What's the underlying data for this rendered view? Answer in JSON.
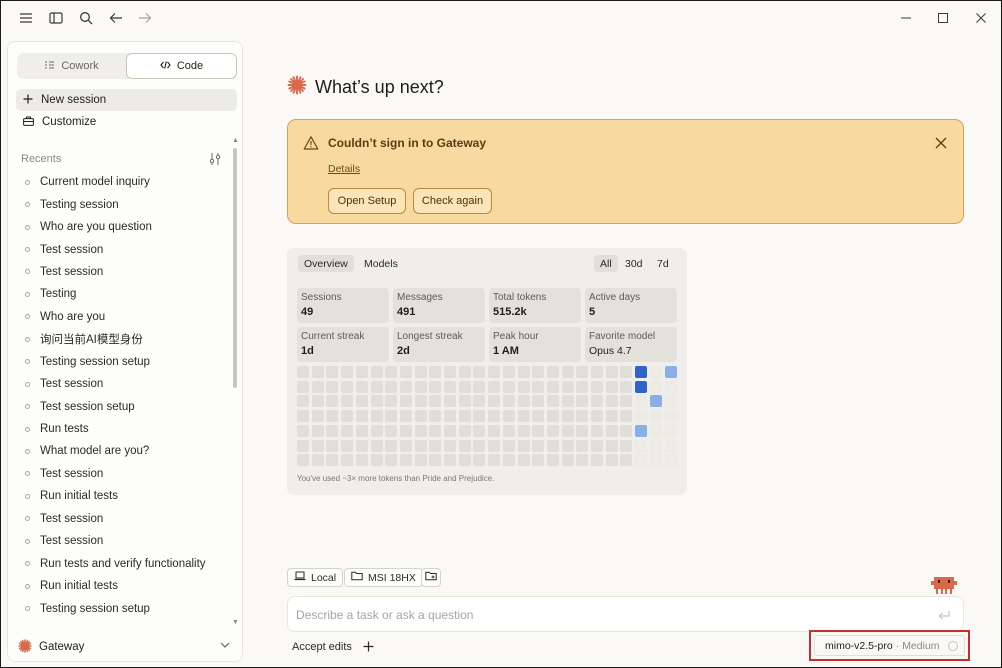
{
  "titlebar": {
    "icons": [
      "menu-icon",
      "sidebar-toggle-icon",
      "search-icon",
      "back-arrow-icon",
      "forward-arrow-icon"
    ],
    "window_controls": [
      "minimize-icon",
      "maximize-icon",
      "close-icon"
    ]
  },
  "sidebar": {
    "modes": [
      {
        "label": "Cowork",
        "icon": "list-icon",
        "active": false
      },
      {
        "label": "Code",
        "icon": "code-icon",
        "active": true
      }
    ],
    "new_session": "New session",
    "customize": "Customize",
    "recents_label": "Recents",
    "recents": [
      "Current model inquiry",
      "Testing session",
      "Who are you question",
      "Test session",
      "Test session",
      "Testing",
      "Who are you",
      "询问当前AI模型身份",
      "Testing session setup",
      "Test session",
      "Test session setup",
      "Run tests",
      "What model are you?",
      "Test session",
      "Run initial tests",
      "Test session",
      "Test session",
      "Run tests and verify functionality",
      "Run initial tests",
      "Testing session setup"
    ],
    "footer": {
      "label": "Gateway"
    }
  },
  "main": {
    "headline": "What’s up next?",
    "alert": {
      "title": "Couldn’t sign in to Gateway",
      "link": "Details",
      "primary_button": "Open Setup",
      "secondary_button": "Check again"
    },
    "stats": {
      "tabs": [
        "Overview",
        "Models"
      ],
      "ranges": [
        "All",
        "30d",
        "7d"
      ],
      "cards": [
        {
          "label": "Sessions",
          "value": "49"
        },
        {
          "label": "Messages",
          "value": "491"
        },
        {
          "label": "Total tokens",
          "value": "515.2k"
        },
        {
          "label": "Active days",
          "value": "5"
        },
        {
          "label": "Current streak",
          "value": "1d"
        },
        {
          "label": "Longest streak",
          "value": "2d"
        },
        {
          "label": "Peak hour",
          "value": "1 AM"
        },
        {
          "label": "Favorite model",
          "value": "Opus 4.7"
        }
      ],
      "heatmap": {
        "columns": 26,
        "rows": 7,
        "active": [
          {
            "col": 23,
            "row": 0,
            "level": 3
          },
          {
            "col": 25,
            "row": 0,
            "level": 1
          },
          {
            "col": 23,
            "row": 1,
            "level": 3
          },
          {
            "col": 24,
            "row": 2,
            "level": 1
          },
          {
            "col": 23,
            "row": 4,
            "level": 1
          }
        ]
      },
      "note": "You've used ~3× more tokens than Pride and Prejudice."
    },
    "chips": [
      {
        "label": "Local",
        "icon": "laptop-icon"
      },
      {
        "label": "MSI 18HX",
        "icon": "folder-icon"
      },
      {
        "label": "",
        "icon": "folder-add-icon"
      }
    ],
    "composer": {
      "placeholder": "Describe a task or ask a question"
    },
    "accept_edits": "Accept edits",
    "model": {
      "name": "mimo-v2.5-pro",
      "separator": "·",
      "effort": "Medium"
    }
  },
  "colors": {
    "accent": "#d9694a",
    "alert_bg": "#f8d9a0",
    "alert_border": "#d9a24e",
    "heat_low": "#8aaee8",
    "heat_high": "#2f63c7",
    "heat_empty": "#e0ded8",
    "highlight": "#c12f2f"
  }
}
